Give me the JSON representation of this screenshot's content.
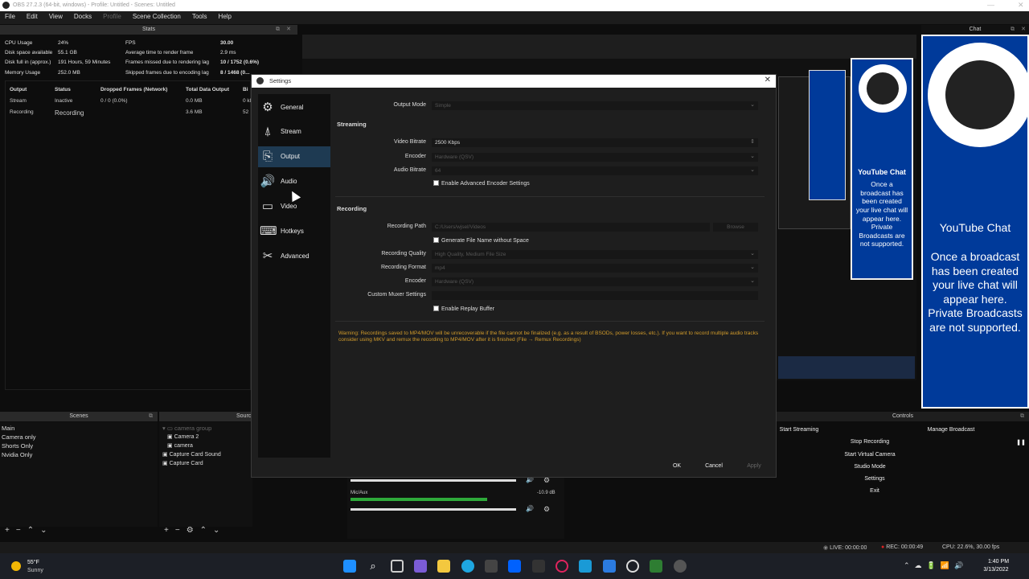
{
  "window": {
    "title": "OBS 27.2.3 (64-bit, windows) - Profile: Untitled - Scenes: Untitled"
  },
  "menu": [
    "File",
    "Edit",
    "View",
    "Docks",
    "Profile",
    "Scene Collection",
    "Tools",
    "Help"
  ],
  "stats": {
    "header": "Stats",
    "cpu_label": "CPU Usage",
    "cpu_value": "24%",
    "disk_label": "Disk space available",
    "disk_value": "55.1 GB",
    "diskfull_label": "Disk full in (approx.)",
    "diskfull_value": "191 Hours, 59 Minutes",
    "mem_label": "Memory Usage",
    "mem_value": "252.0 MB",
    "fps_label": "FPS",
    "fps_value": "30.00",
    "render_label": "Average time to render frame",
    "render_value": "2.9 ms",
    "missed_label": "Frames missed due to rendering lag",
    "missed_value": "10 / 1752 (0.6%)",
    "skipped_label": "Skipped frames due to encoding lag",
    "skipped_value": "8 / 1468 (0..."
  },
  "output_table": {
    "headers": [
      "Output",
      "Status",
      "Dropped Frames (Network)",
      "Total Data Output",
      "Bi"
    ],
    "rows": [
      [
        "Stream",
        "Inactive",
        "0 / 0 (0.0%)",
        "0.0 MB",
        "0 kl"
      ],
      [
        "Recording",
        "Recording",
        "",
        "3.6 MB",
        "52"
      ]
    ]
  },
  "chat": {
    "title": "YouTube Chat",
    "dock_title": "Chat",
    "message": "Once a broadcast has been created your live chat will appear here. Private Broadcasts are not supported."
  },
  "scenes": {
    "header": "Scenes",
    "items": [
      "Main",
      "Camera only",
      "Shorts Only",
      "Nvidia Only"
    ]
  },
  "sources": {
    "header": "Sourc",
    "items": [
      "camera group",
      "Camera 2",
      "camera",
      "Capture Card Sound",
      "Capture Card"
    ]
  },
  "mixer": {
    "mic_label": "Mic/Aux",
    "mic_db": "-10.9 dB"
  },
  "controls": {
    "header": "Controls",
    "start_streaming": "Start Streaming",
    "manage_broadcast": "Manage Broadcast",
    "stop_recording": "Stop Recording",
    "start_virtual_camera": "Start Virtual Camera",
    "studio_mode": "Studio Mode",
    "settings": "Settings",
    "exit": "Exit"
  },
  "statusbar": {
    "live": "LIVE: 00:00:00",
    "rec": "REC: 00:00:49",
    "cpu": "CPU: 22.6%, 30.00 fps"
  },
  "taskbar": {
    "weather_temp": "55°F",
    "weather_desc": "Sunny",
    "time": "1:40 PM",
    "date": "3/13/2022"
  },
  "settings": {
    "title": "Settings",
    "nav": [
      "General",
      "Stream",
      "Output",
      "Audio",
      "Video",
      "Hotkeys",
      "Advanced"
    ],
    "selected": "Output",
    "output_mode_label": "Output Mode",
    "output_mode_value": "Simple",
    "streaming_header": "Streaming",
    "video_bitrate_label": "Video Bitrate",
    "video_bitrate_value": "2500 Kbps",
    "encoder_label": "Encoder",
    "stream_encoder_value": "Hardware (QSV)",
    "audio_bitrate_label": "Audio Bitrate",
    "audio_bitrate_value": "64",
    "adv_encoder_label": "Enable Advanced Encoder Settings",
    "recording_header": "Recording",
    "recording_path_label": "Recording Path",
    "recording_path_value": "C:/Users/wjsel/Videos",
    "browse_label": "Browse",
    "gen_filename_label": "Generate File Name without Space",
    "quality_label": "Recording Quality",
    "quality_value": "High Quality, Medium File Size",
    "format_label": "Recording Format",
    "format_value": "mp4",
    "rec_encoder_value": "Hardware (QSV)",
    "muxer_label": "Custom Muxer Settings",
    "replay_label": "Enable Replay Buffer",
    "warning": "Warning: Recordings saved to MP4/MOV will be unrecoverable if the file cannot be finalized (e.g. as a result of BSODs, power losses, etc.). If you want to record multiple audio tracks consider using MKV and remux the recording to MP4/MOV after it is finished (File → Remux Recordings)",
    "ok": "OK",
    "cancel": "Cancel",
    "apply": "Apply"
  },
  "colors": {
    "accent_blue": "#003a9a",
    "warning": "#d19b2b",
    "selected_nav": "#1e3a52"
  }
}
